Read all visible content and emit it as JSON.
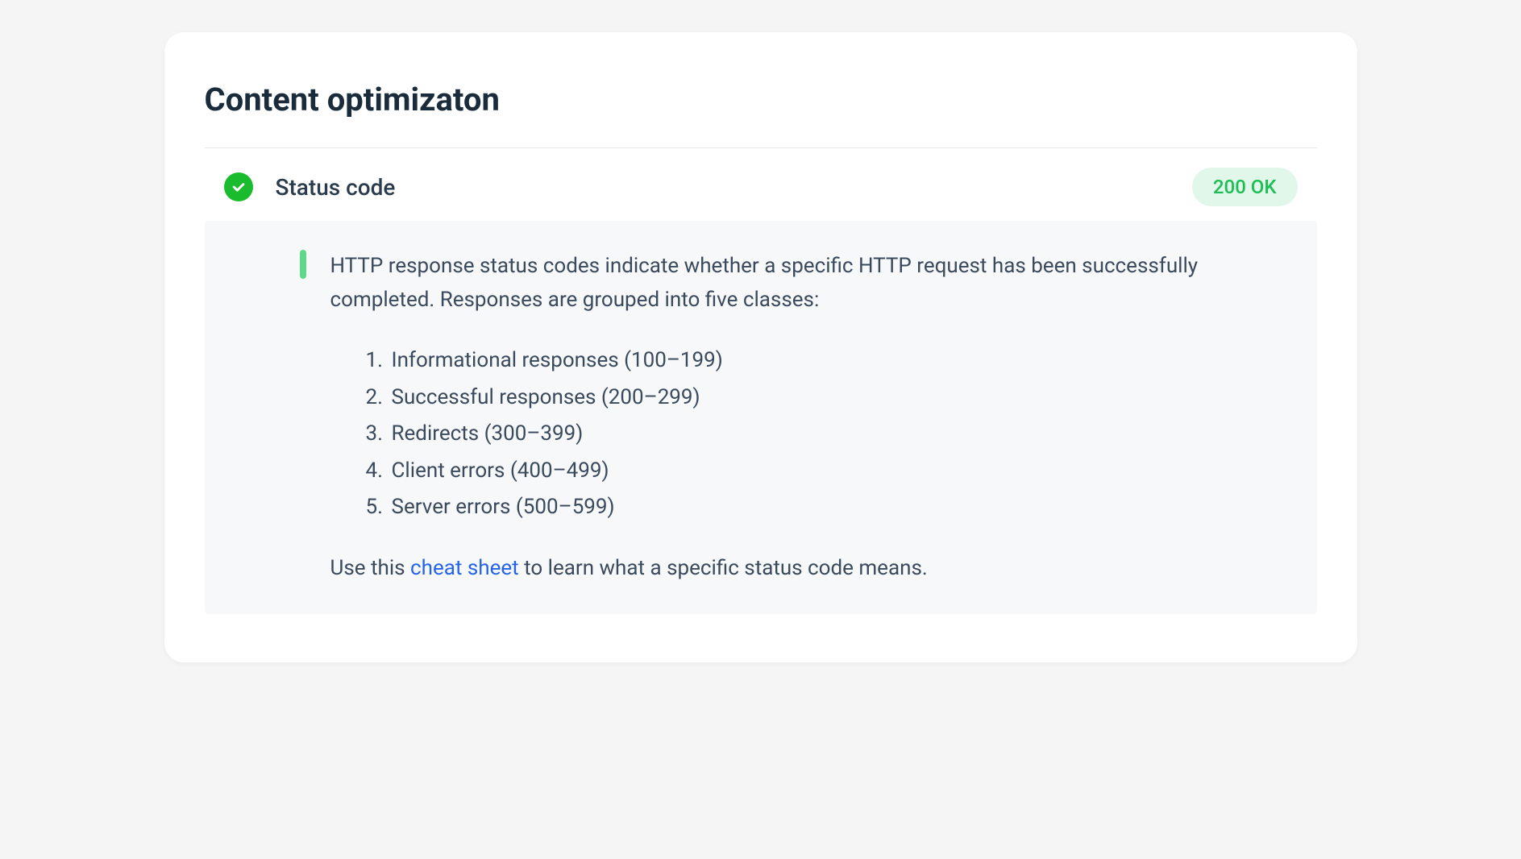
{
  "heading": "Content optimizaton",
  "status": {
    "title": "Status code",
    "badge": "200 OK"
  },
  "info": {
    "intro": "HTTP response status codes indicate whether a specific HTTP request has been successfully completed. Responses are grouped into five classes:",
    "classes": [
      "Informational responses (100–199)",
      "Successful responses (200–299)",
      "Redirects (300–399)",
      "Client errors (400–499)",
      "Server errors (500–599)"
    ],
    "footer_prefix": "Use this ",
    "footer_link": "cheat sheet",
    "footer_suffix": " to learn what a specific status code means."
  }
}
